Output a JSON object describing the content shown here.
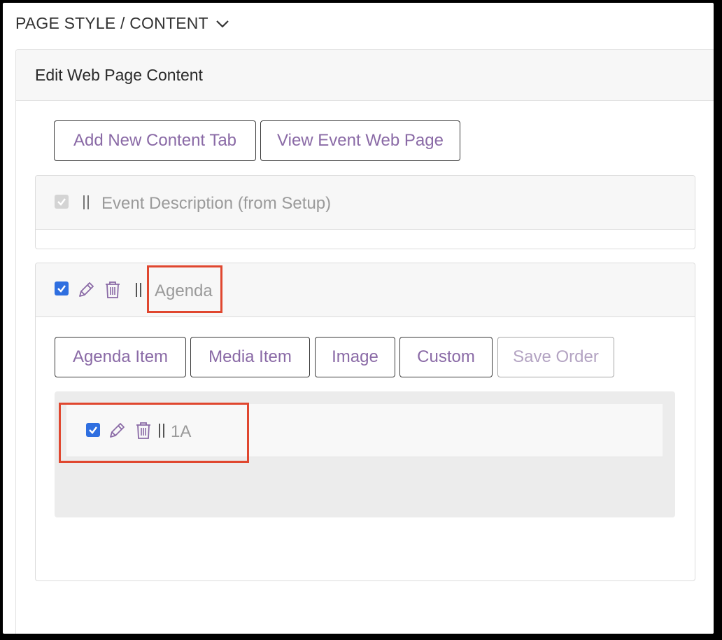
{
  "header": {
    "section_title": "PAGE STYLE / CONTENT"
  },
  "panel": {
    "title": "Edit Web Page Content"
  },
  "toolbar": {
    "add_tab_label": "Add New Content Tab",
    "view_page_label": "View Event Web Page"
  },
  "tabs": [
    {
      "label": "Event Description (from Setup)",
      "checked": true,
      "disabled": true
    },
    {
      "label": "Agenda",
      "checked": true,
      "disabled": false
    }
  ],
  "agenda_buttons": {
    "agenda_item": "Agenda Item",
    "media_item": "Media Item",
    "image": "Image",
    "custom": "Custom",
    "save_order": "Save Order"
  },
  "agenda_items": [
    {
      "label": "1A",
      "checked": true
    }
  ],
  "colors": {
    "accent": "#8a6aa6",
    "checkbox": "#2f6fe0",
    "highlight": "#e0472f"
  }
}
